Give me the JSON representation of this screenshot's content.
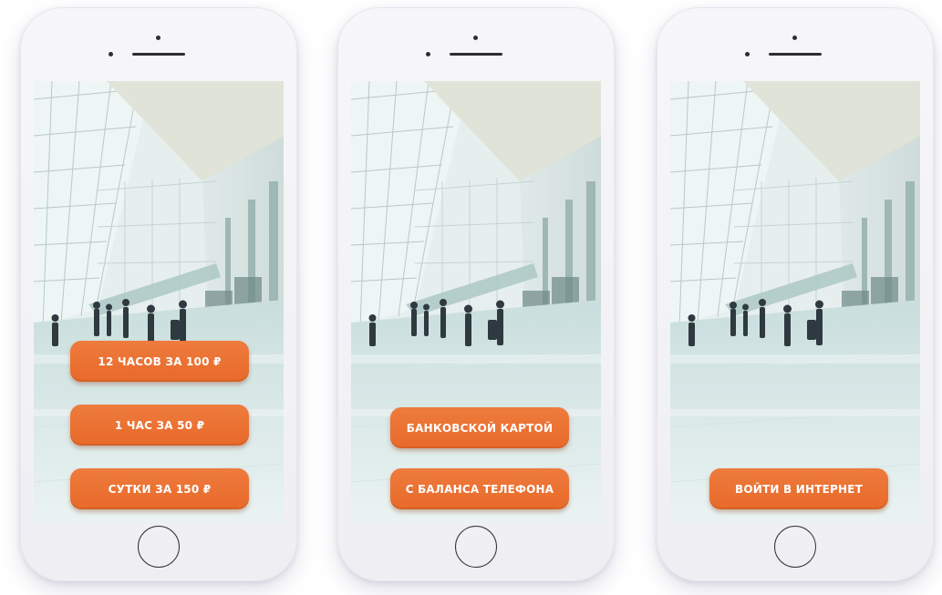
{
  "phones": [
    {
      "buttons": [
        {
          "label": "12 ЧАСОВ ЗА 100 ₽"
        },
        {
          "label": "1 ЧАС ЗА 50 ₽"
        },
        {
          "label": "СУТКИ ЗА 150 ₽"
        }
      ]
    },
    {
      "buttons": [
        {
          "label": "БАНКОВСКОЙ КАРТОЙ"
        },
        {
          "label": "С БАЛАНСА ТЕЛЕФОНА"
        }
      ]
    },
    {
      "buttons": [
        {
          "label": "ВОЙТИ В ИНТЕРНЕТ"
        }
      ]
    }
  ],
  "colors": {
    "button": "#e86a2a",
    "button_text": "#ffffff",
    "phone_body": "#f3f3f6"
  },
  "icons": [
    "home-button-icon",
    "camera-icon",
    "speaker-icon"
  ]
}
